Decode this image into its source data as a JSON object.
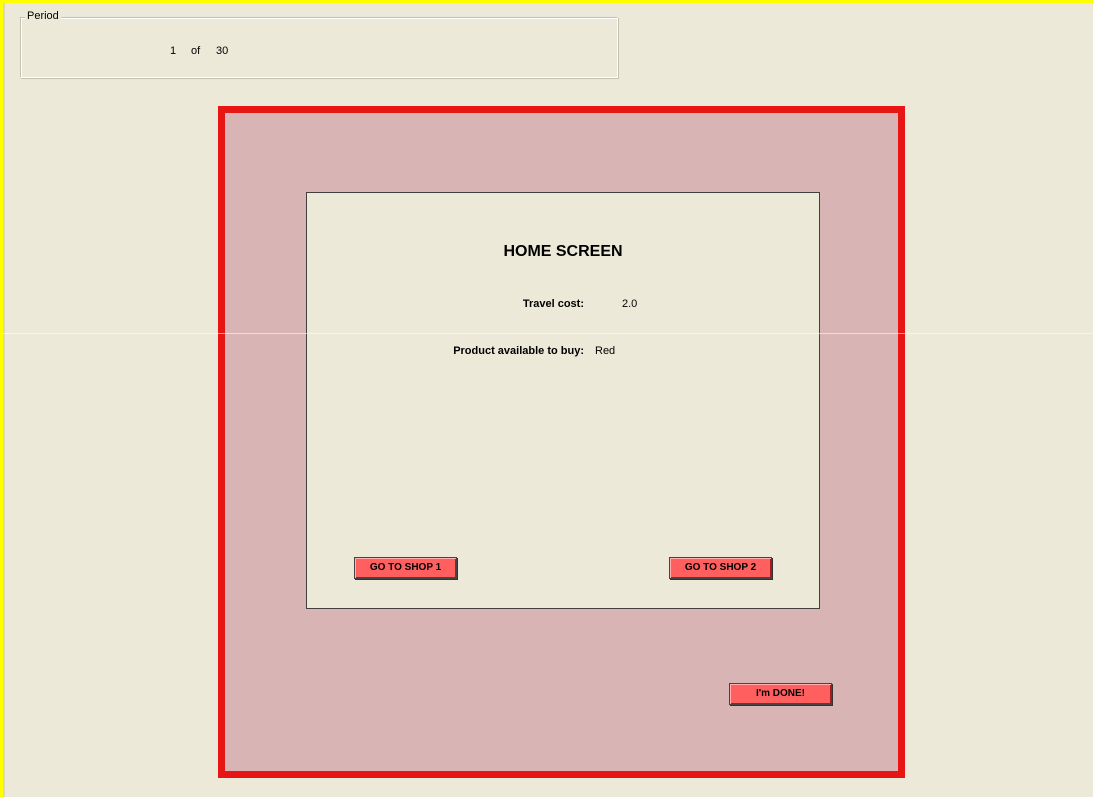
{
  "period": {
    "legend": "Period",
    "current": "1",
    "of_label": "of",
    "total": "30"
  },
  "home": {
    "title": "HOME SCREEN",
    "travel_cost_label": "Travel cost:",
    "travel_cost_value": "2.0",
    "product_label": "Product available to buy:",
    "product_value": "Red"
  },
  "buttons": {
    "shop1": "GO TO SHOP 1",
    "shop2": "GO TO SHOP 2",
    "done": "I'm DONE!"
  },
  "colors": {
    "background": "#ece9d8",
    "panel_border": "#e81515",
    "panel_fill": "#d9b4b5",
    "button_fill": "#ff5f5f",
    "frame_accent": "#ffff00"
  }
}
